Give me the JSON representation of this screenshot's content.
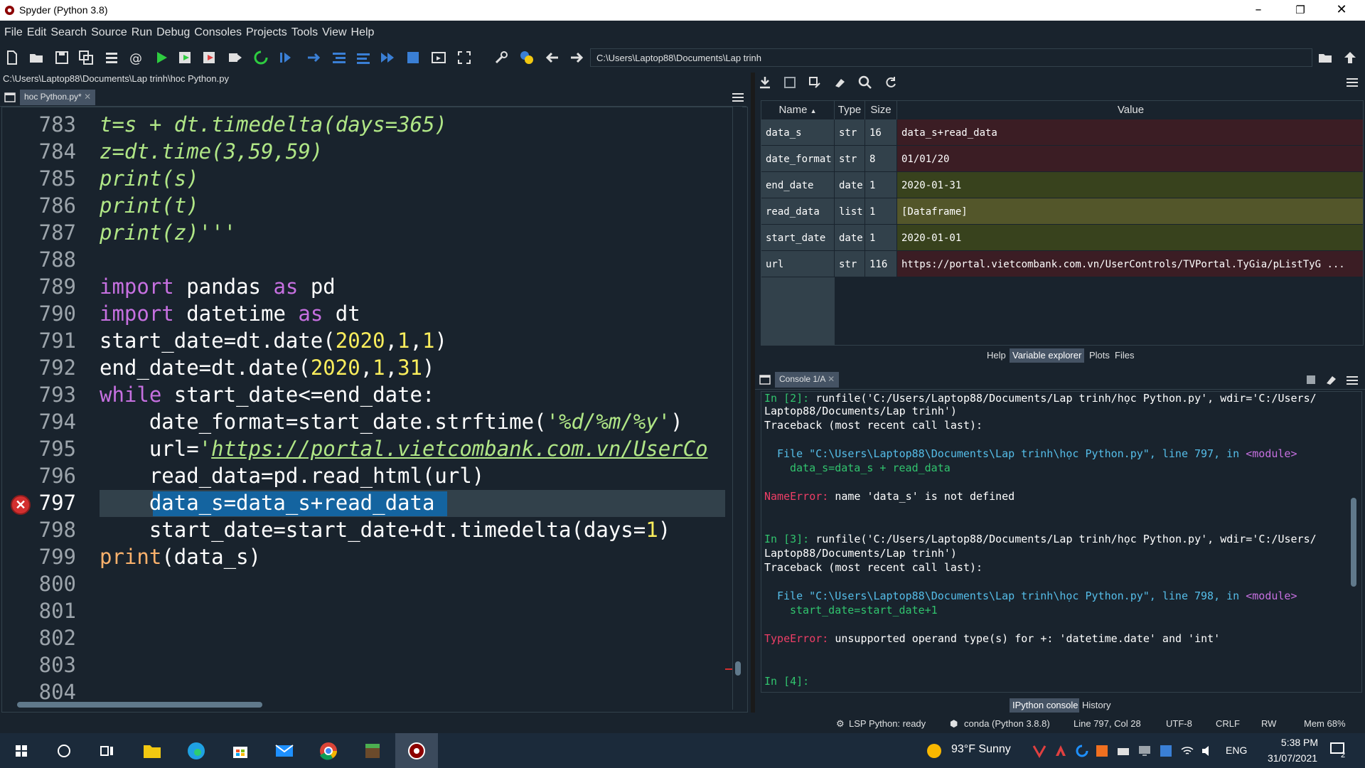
{
  "window": {
    "title": "Spyder (Python 3.8)"
  },
  "menu": [
    "File",
    "Edit",
    "Search",
    "Source",
    "Run",
    "Debug",
    "Consoles",
    "Projects",
    "Tools",
    "View",
    "Help"
  ],
  "toolbar": {
    "path": "C:\\Users\\Laptop88\\Documents\\Lap trinh"
  },
  "editor": {
    "file_path": "C:\\Users\\Laptop88\\Documents\\Lap trinh\\hoc Python.py",
    "tab_label": "hoc Python.py*",
    "line_numbers": [
      "783",
      "784",
      "785",
      "786",
      "787",
      "788",
      "789",
      "790",
      "791",
      "792",
      "793",
      "794",
      "795",
      "796",
      "797",
      "798",
      "799",
      "800",
      "801",
      "802",
      "803",
      "804"
    ],
    "current_line": "797",
    "lines": [
      "t=s + dt.timedelta(days=365)",
      "z=dt.time(3,59,59)",
      "print(s)",
      "print(t)",
      "print(z)'''",
      "",
      "import pandas as pd",
      "import datetime as dt",
      "start_date=dt.date(2020,1,1)",
      "end_date=dt.date(2020,1,31)",
      "while start_date<=end_date:",
      "    date_format=start_date.strftime('%d/%m/%y')",
      "    url='https://portal.vietcombank.com.vn/UserCo",
      "    read_data=pd.read_html(url)",
      "    data_s=data_s+read_data",
      "    start_date=start_date+dt.timedelta(days=1)",
      "print(data_s)"
    ]
  },
  "variable_explorer": {
    "columns": [
      "Name",
      "Type",
      "Size",
      "Value"
    ],
    "rows": [
      {
        "name": "data_s",
        "type": "str",
        "size": "16",
        "value": "data_s+read_data",
        "color": "#3b1d24"
      },
      {
        "name": "date_format",
        "type": "str",
        "size": "8",
        "value": "01/01/20",
        "color": "#3b1d24"
      },
      {
        "name": "end_date",
        "type": "date",
        "size": "1",
        "value": "2020-01-31",
        "color": "#38421d"
      },
      {
        "name": "read_data",
        "type": "list",
        "size": "1",
        "value": "[Dataframe]",
        "color": "#53562a"
      },
      {
        "name": "start_date",
        "type": "date",
        "size": "1",
        "value": "2020-01-01",
        "color": "#38421d"
      },
      {
        "name": "url",
        "type": "str",
        "size": "116",
        "value": "https://portal.vietcombank.com.vn/UserControls/TVPortal.TyGia/pListTyG ...",
        "color": "#3b1d24"
      }
    ],
    "pane_tabs": [
      "Help",
      "Variable explorer",
      "Plots",
      "Files"
    ]
  },
  "console": {
    "tab_label": "Console 1/A",
    "bottom_tabs": [
      "IPython console",
      "History"
    ],
    "in2_prompt": "In [2]: ",
    "in2_cmd": "runfile('C:/Users/Laptop88/Documents/Lap trinh/học Python.py', wdir='C:/Users/",
    "in2_cmd2": "Laptop88/Documents/Lap trinh')",
    "traceback1": "Traceback (most recent call last):",
    "file1_a": "File \"C:\\Users\\Laptop88\\Documents\\Lap trinh\\học Python.py\", line 797, in ",
    "file1_mod": "<module>",
    "code1": "data_s=data_s + read_data",
    "err1_name": "NameError:",
    "err1_msg": " name 'data_s' is not defined",
    "in3_prompt": "In [3]: ",
    "in3_cmd": "runfile('C:/Users/Laptop88/Documents/Lap trinh/học Python.py', wdir='C:/Users/",
    "in3_cmd2": "Laptop88/Documents/Lap trinh')",
    "traceback2": "Traceback (most recent call last):",
    "file2_a": "File \"C:\\Users\\Laptop88\\Documents\\Lap trinh\\học Python.py\", line 798, in ",
    "file2_mod": "<module>",
    "code2": "start_date=start_date+1",
    "err2_name": "TypeError:",
    "err2_msg": " unsupported operand type(s) for +: 'datetime.date' and 'int'",
    "in4_prompt": "In [4]:"
  },
  "status": {
    "lsp": "LSP Python: ready",
    "env": "conda (Python 3.8.8)",
    "cursor": "Line 797, Col 28",
    "encoding": "UTF-8",
    "eol": "CRLF",
    "mode": "RW",
    "mem": "Mem 68%"
  },
  "taskbar": {
    "weather": "93°F  Sunny",
    "lang": "ENG",
    "time": "5:38 PM",
    "date": "31/07/2021",
    "notif_count": "2"
  }
}
